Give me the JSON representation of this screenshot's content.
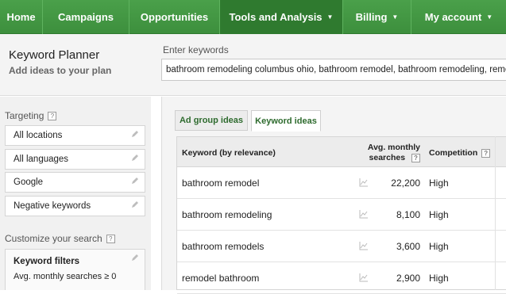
{
  "nav": {
    "items": [
      {
        "label": "Home",
        "caret": ""
      },
      {
        "label": "Campaigns",
        "caret": ""
      },
      {
        "label": "Opportunities",
        "caret": ""
      },
      {
        "label": "Tools and Analysis",
        "caret": "▼"
      },
      {
        "label": "Billing",
        "caret": "▼"
      },
      {
        "label": "My account",
        "caret": "▼"
      }
    ],
    "active_index": 3
  },
  "header": {
    "title": "Keyword Planner",
    "subtitle": "Add ideas to your plan",
    "keywords_label": "Enter keywords",
    "keywords_value": "bathroom remodeling columbus ohio, bathroom remodel, bathroom remodeling, remodeling"
  },
  "sidebar": {
    "targeting_label": "Targeting",
    "help_glyph": "?",
    "targeting": [
      "All locations",
      "All languages",
      "Google",
      "Negative keywords"
    ],
    "customize_label": "Customize your search",
    "keyword_filters": {
      "title": "Keyword filters",
      "text": "Avg. monthly searches ≥ 0"
    }
  },
  "tabs": [
    {
      "label": "Ad group ideas",
      "active": false
    },
    {
      "label": "Keyword ideas",
      "active": true
    }
  ],
  "table": {
    "headers": {
      "keyword": "Keyword (by relevance)",
      "avg_line1": "Avg. monthly",
      "avg_line2": "searches",
      "competition": "Competition"
    },
    "rows": [
      {
        "keyword": "bathroom remodel",
        "avg": "22,200",
        "competition": "High"
      },
      {
        "keyword": "bathroom remodeling",
        "avg": "8,100",
        "competition": "High"
      },
      {
        "keyword": "bathroom remodels",
        "avg": "3,600",
        "competition": "High"
      },
      {
        "keyword": "remodel bathroom",
        "avg": "2,900",
        "competition": "High"
      }
    ]
  },
  "colors": {
    "nav_green": "#3d8f3d",
    "nav_active": "#2f7a2f",
    "tab_text": "#2e6b2e"
  }
}
